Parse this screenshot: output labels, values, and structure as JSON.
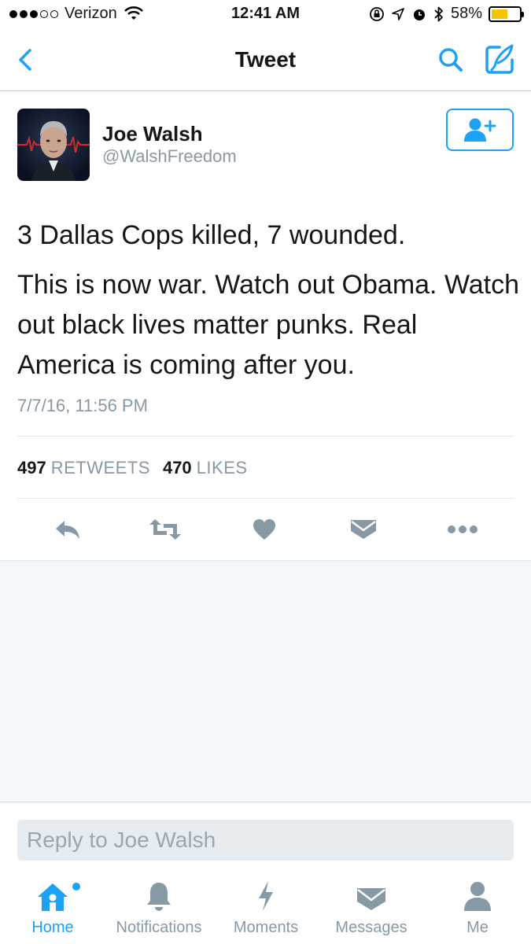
{
  "status_bar": {
    "carrier": "Verizon",
    "time": "12:41 AM",
    "battery_percent_text": "58%",
    "battery_level": 0.58,
    "signal_bars_filled": 3,
    "signal_bars_total": 5
  },
  "nav": {
    "title": "Tweet"
  },
  "tweet": {
    "user_name": "Joe Walsh",
    "user_handle": "@WalshFreedom",
    "text_lines": [
      "3 Dallas Cops killed, 7 wounded.",
      "This is now war. Watch out Obama. Watch out black lives matter punks. Real America is coming after you."
    ],
    "timestamp": "7/7/16, 11:56 PM",
    "retweets_count": "497",
    "retweets_label": "RETWEETS",
    "likes_count": "470",
    "likes_label": "LIKES"
  },
  "reply": {
    "placeholder": "Reply to Joe Walsh"
  },
  "tabs": [
    {
      "label": "Home",
      "icon": "home-icon",
      "active": true
    },
    {
      "label": "Notifications",
      "icon": "bell-icon",
      "active": false
    },
    {
      "label": "Moments",
      "icon": "lightning-icon",
      "active": false
    },
    {
      "label": "Messages",
      "icon": "envelope-icon",
      "active": false
    },
    {
      "label": "Me",
      "icon": "person-icon",
      "active": false
    }
  ],
  "colors": {
    "accent": "#1da1f2",
    "muted_text": "#8899a6",
    "action_icon": "#8899a6",
    "background_gray": "#f5f8fa",
    "battery_fill": "#f5c400"
  }
}
